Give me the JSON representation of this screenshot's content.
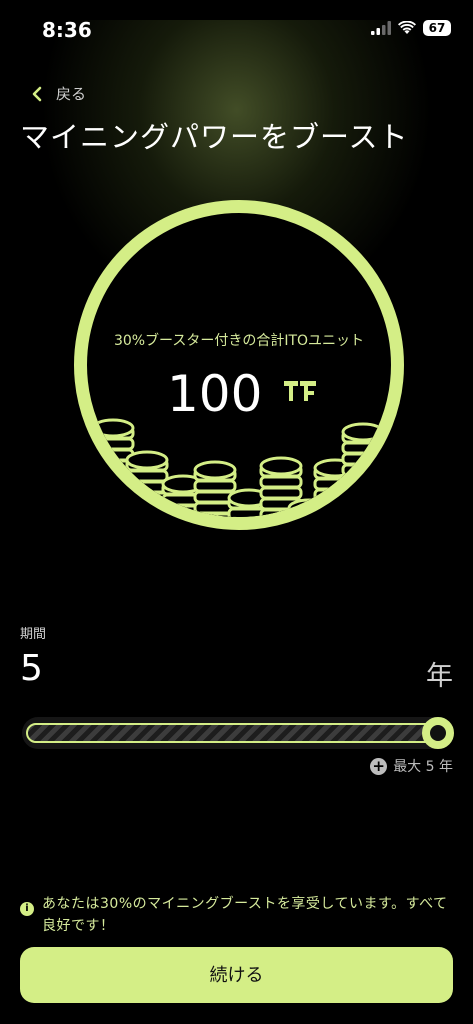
{
  "status_bar": {
    "time": "8:36",
    "battery": "67"
  },
  "nav": {
    "back_label": "戻る"
  },
  "page": {
    "title": "マイニングパワーをブースト"
  },
  "boost_card": {
    "label": "30%ブースター付きの合計ITOユニット",
    "value": "100"
  },
  "period": {
    "label": "期間",
    "value": "5",
    "unit": "年",
    "slider_fraction": 1.0,
    "max_label": "最大 5 年"
  },
  "notice": {
    "text": "あなたは30%のマイニングブーストを享受しています。すべて良好です！"
  },
  "cta": {
    "label": "続ける"
  },
  "colors": {
    "accent": "#d4ee86",
    "background": "#000000"
  }
}
